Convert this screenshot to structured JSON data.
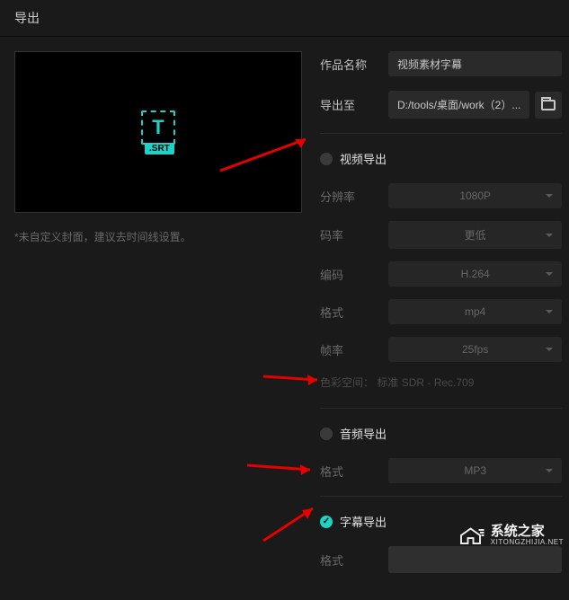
{
  "header": {
    "title": "导出"
  },
  "preview": {
    "badge": ".SRT",
    "note": "*未自定义封面，建议去时间线设置。"
  },
  "form": {
    "name_label": "作品名称",
    "name_value": "视频素材字幕",
    "export_to_label": "导出至",
    "export_to_value": "D:/tools/桌面/work（2）..."
  },
  "video": {
    "section": "视频导出",
    "resolution_label": "分辨率",
    "resolution_value": "1080P",
    "bitrate_label": "码率",
    "bitrate_value": "更低",
    "codec_label": "编码",
    "codec_value": "H.264",
    "format_label": "格式",
    "format_value": "mp4",
    "fps_label": "帧率",
    "fps_value": "25fps",
    "colorspace_label": "色彩空间：",
    "colorspace_value": "标准 SDR - Rec.709"
  },
  "audio": {
    "section": "音频导出",
    "format_label": "格式",
    "format_value": "MP3"
  },
  "subtitle": {
    "section": "字幕导出",
    "format_label": "格式"
  },
  "watermark": {
    "main": "系统之家",
    "sub": "XITONGZHIJIA.NET"
  }
}
